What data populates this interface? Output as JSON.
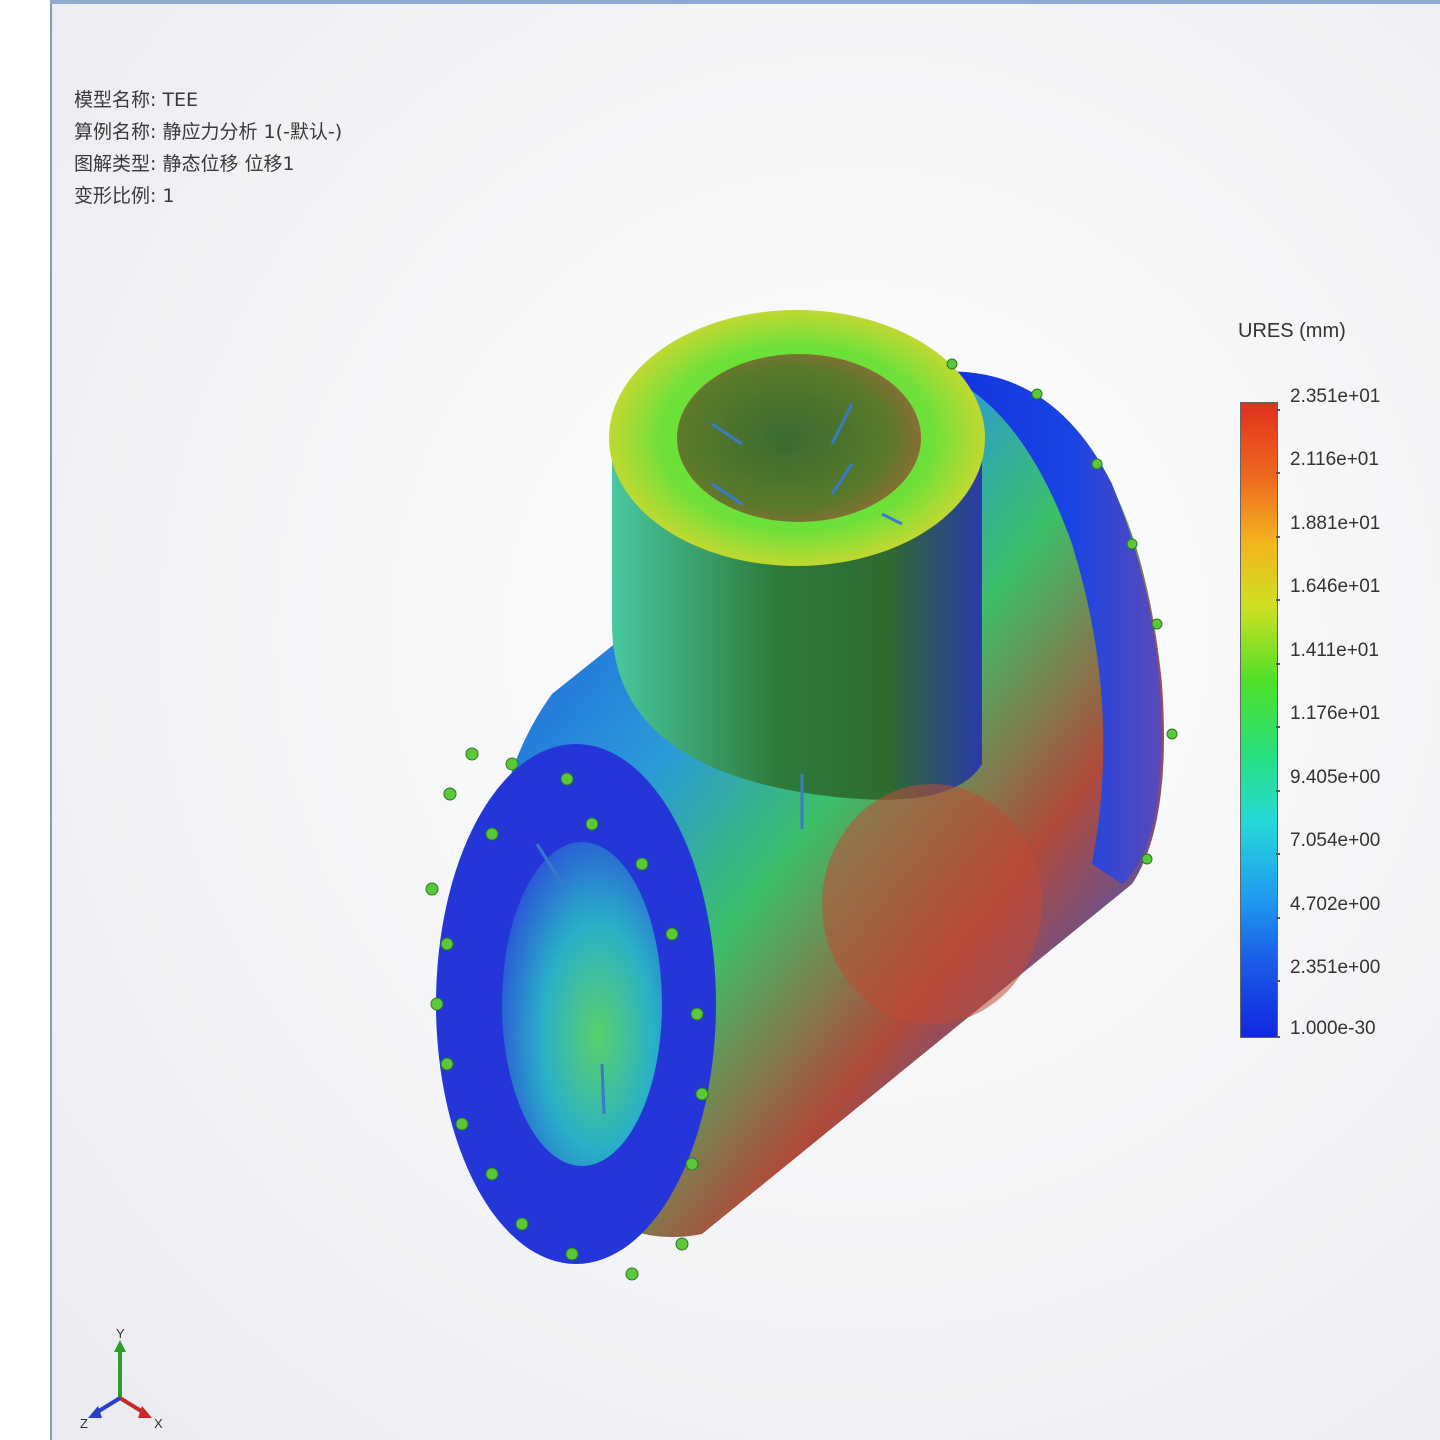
{
  "study_info": {
    "model_name": "模型名称: TEE",
    "study_name": "算例名称: 静应力分析 1(-默认-)",
    "plot_type": "图解类型: 静态位移 位移1",
    "deformation_scale": "变形比例: 1"
  },
  "legend": {
    "title": "URES (mm)",
    "labels": [
      "2.351e+01",
      "2.116e+01",
      "1.881e+01",
      "1.646e+01",
      "1.411e+01",
      "1.176e+01",
      "9.405e+00",
      "7.054e+00",
      "4.702e+00",
      "2.351e+00",
      "1.000e-30"
    ],
    "max_color": "#e0301e",
    "min_color": "#1226e0"
  },
  "triad": {
    "x_label": "X",
    "y_label": "Y",
    "z_label": "Z"
  }
}
